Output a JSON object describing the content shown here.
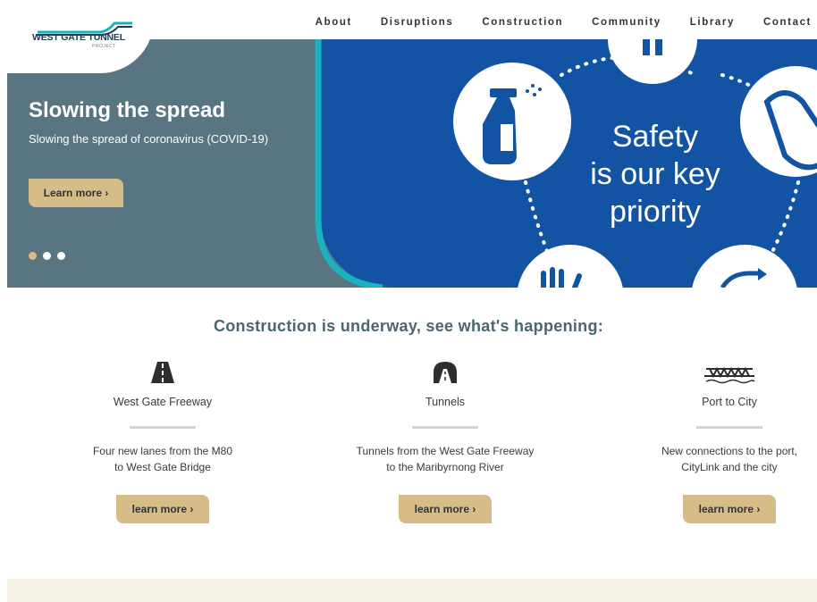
{
  "logo": {
    "title": "WEST GATE TUNNEL",
    "subtitle": "PROJECT"
  },
  "nav": [
    "About",
    "Disruptions",
    "Construction",
    "Community",
    "Library",
    "Contact"
  ],
  "hero": {
    "title": "Slowing the spread",
    "subtitle": "Slowing the spread of coronavirus (COVID-19)",
    "button": "Learn more ›",
    "poster_lines": [
      "Safety",
      "is our key",
      "priority"
    ],
    "slide_index": 1,
    "slide_count": 3
  },
  "construction": {
    "heading": "Construction is underway, see what's happening:",
    "items": [
      {
        "name": "West Gate Freeway",
        "desc1": "Four new lanes from the M80",
        "desc2": "to West Gate Bridge",
        "button": "learn more ›",
        "icon": "road-icon"
      },
      {
        "name": "Tunnels",
        "desc1": "Tunnels from the West Gate Freeway",
        "desc2": "to the Maribyrnong River",
        "button": "learn more ›",
        "icon": "tunnel-icon"
      },
      {
        "name": "Port to City",
        "desc1": "New connections to the port,",
        "desc2": "CityLink and the city",
        "button": "learn more ›",
        "icon": "bridge-icon"
      }
    ]
  },
  "colors": {
    "hero_grey": "#597582",
    "hero_blue": "#1353a3",
    "accent_gold": "#d6bc87",
    "teal": "#19b3c0",
    "heading": "#4a6672"
  }
}
